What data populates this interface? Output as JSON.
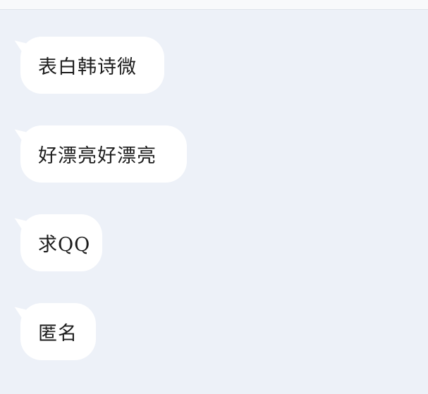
{
  "messages": [
    {
      "text": "表白韩诗微"
    },
    {
      "text": "好漂亮好漂亮"
    },
    {
      "text": "求QQ"
    },
    {
      "text": "匿名"
    }
  ],
  "colors": {
    "background": "#edf1f8",
    "bubble": "#ffffff",
    "text": "#1c1c1c",
    "top_bar": "#f8f9fb"
  }
}
